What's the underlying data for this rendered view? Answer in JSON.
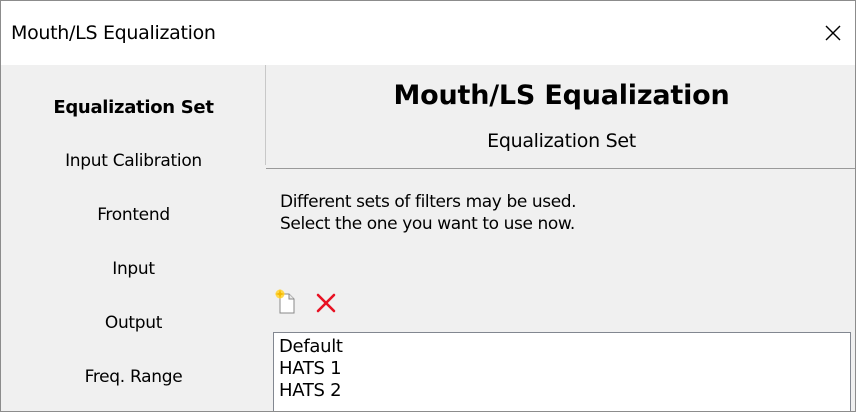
{
  "window": {
    "title": "Mouth/LS Equalization",
    "close_symbol": "✕",
    "close_icon": "close-icon"
  },
  "sidebar": {
    "items": [
      {
        "label": "Equalization Set",
        "active": true
      },
      {
        "label": "Input Calibration",
        "active": false
      },
      {
        "label": "Frontend",
        "active": false
      },
      {
        "label": "Input",
        "active": false
      },
      {
        "label": "Output",
        "active": false
      },
      {
        "label": "Freq. Range",
        "active": false
      }
    ]
  },
  "header": {
    "title": "Mouth/LS Equalization",
    "subtitle": "Equalization Set"
  },
  "content": {
    "description_line1": "Different sets of filters may be used.",
    "description_line2": "Select the one you want to use now.",
    "toolbar": {
      "new_icon": "new-document-icon",
      "delete_icon": "delete-icon",
      "delete_color": "#e81123"
    },
    "list": {
      "items": [
        "Default",
        "HATS 1",
        "HATS 2"
      ]
    }
  }
}
